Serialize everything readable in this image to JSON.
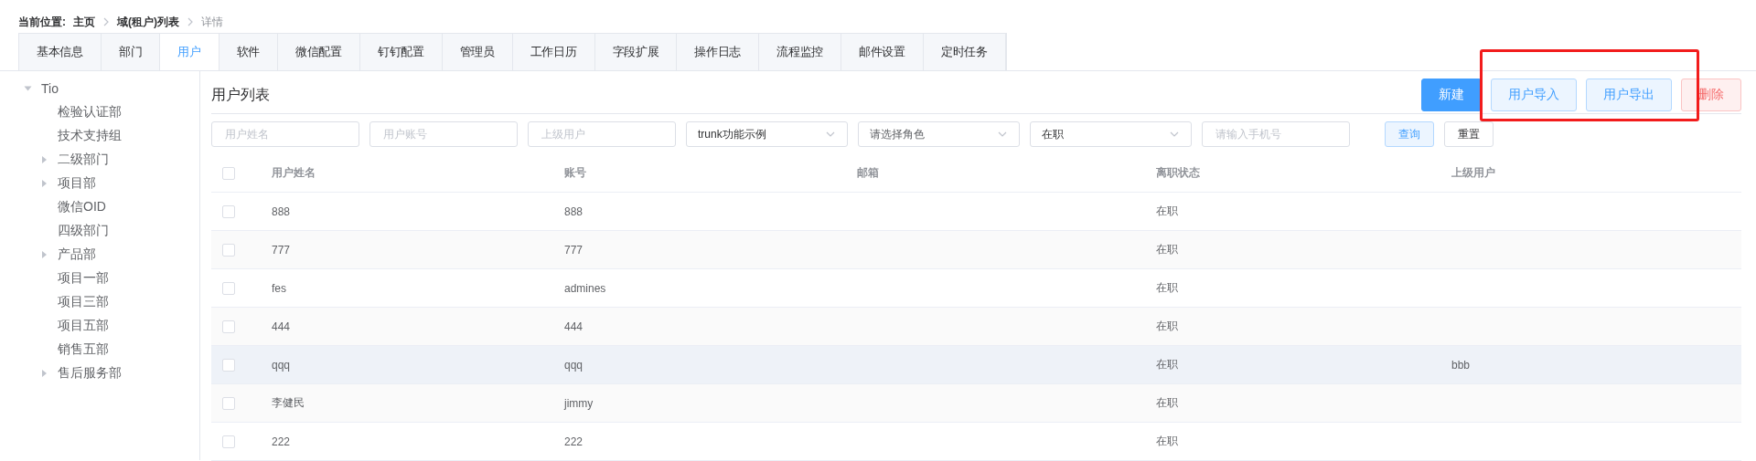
{
  "breadcrumb": {
    "label": "当前位置:",
    "items": [
      "主页",
      "域(租户)列表",
      "详情"
    ]
  },
  "tabs": [
    {
      "label": "基本信息",
      "selected": false
    },
    {
      "label": "部门",
      "selected": false
    },
    {
      "label": "用户",
      "selected": true
    },
    {
      "label": "软件",
      "selected": false
    },
    {
      "label": "微信配置",
      "selected": false
    },
    {
      "label": "钉钉配置",
      "selected": false
    },
    {
      "label": "管理员",
      "selected": false
    },
    {
      "label": "工作日历",
      "selected": false
    },
    {
      "label": "字段扩展",
      "selected": false
    },
    {
      "label": "操作日志",
      "selected": false
    },
    {
      "label": "流程监控",
      "selected": false
    },
    {
      "label": "邮件设置",
      "selected": false
    },
    {
      "label": "定时任务",
      "selected": false
    }
  ],
  "tree": [
    {
      "label": "Tio",
      "expandable": true,
      "expanded": true,
      "children": [
        {
          "label": "检验认证部",
          "expandable": false,
          "expanded": false
        },
        {
          "label": "技术支持组",
          "expandable": false,
          "expanded": false
        },
        {
          "label": "二级部门",
          "expandable": true,
          "expanded": false
        },
        {
          "label": "项目部",
          "expandable": true,
          "expanded": false
        },
        {
          "label": "微信OID",
          "expandable": false,
          "expanded": false
        },
        {
          "label": "四级部门",
          "expandable": false,
          "expanded": false
        },
        {
          "label": "产品部",
          "expandable": true,
          "expanded": false
        },
        {
          "label": "项目一部",
          "expandable": false,
          "expanded": false
        },
        {
          "label": "项目三部",
          "expandable": false,
          "expanded": false
        },
        {
          "label": "项目五部",
          "expandable": false,
          "expanded": false
        },
        {
          "label": "销售五部",
          "expandable": false,
          "expanded": false
        },
        {
          "label": "售后服务部",
          "expandable": true,
          "expanded": false
        }
      ]
    }
  ],
  "panel_title": "用户列表",
  "actions": [
    {
      "label": "新建",
      "kind": "primary"
    },
    {
      "label": "用户导入",
      "kind": "plain"
    },
    {
      "label": "用户导出",
      "kind": "plain"
    },
    {
      "label": "删除",
      "kind": "danger"
    }
  ],
  "filters": [
    {
      "kind": "input",
      "placeholder": "用户姓名"
    },
    {
      "kind": "input",
      "placeholder": "用户账号"
    },
    {
      "kind": "input",
      "placeholder": "上级用户"
    },
    {
      "kind": "select",
      "value": "trunk功能示例"
    },
    {
      "kind": "select",
      "placeholder": "请选择角色"
    },
    {
      "kind": "select",
      "value": "在职"
    },
    {
      "kind": "input",
      "placeholder": "请输入手机号"
    }
  ],
  "filter_buttons": [
    {
      "label": "查询",
      "kind": "primary"
    },
    {
      "label": "重置",
      "kind": "plain"
    }
  ],
  "table": {
    "all_checked": false,
    "columns": [
      "用户姓名",
      "账号",
      "邮箱",
      "离职状态",
      "上级用户"
    ],
    "rows": [
      {
        "cells": [
          "888",
          "888",
          "",
          "在职",
          ""
        ],
        "checked": false,
        "hovered": false
      },
      {
        "cells": [
          "777",
          "777",
          "",
          "在职",
          ""
        ],
        "checked": false,
        "hovered": false
      },
      {
        "cells": [
          "fes",
          "admines",
          "",
          "在职",
          ""
        ],
        "checked": false,
        "hovered": false
      },
      {
        "cells": [
          "444",
          "444",
          "",
          "在职",
          ""
        ],
        "checked": false,
        "hovered": false
      },
      {
        "cells": [
          "qqq",
          "qqq",
          "",
          "在职",
          "bbb"
        ],
        "checked": false,
        "hovered": true
      },
      {
        "cells": [
          "李健民",
          "jimmy",
          "",
          "在职",
          ""
        ],
        "checked": false,
        "hovered": false
      },
      {
        "cells": [
          "222",
          "222",
          "",
          "在职",
          ""
        ],
        "checked": false,
        "hovered": false
      }
    ]
  },
  "annotation": {
    "kind": "highlight"
  }
}
